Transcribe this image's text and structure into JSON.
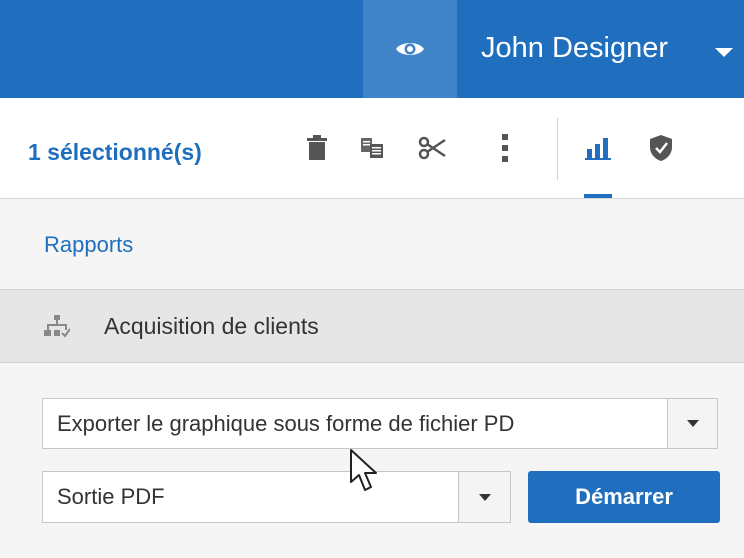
{
  "header": {
    "user_name": "John Designer",
    "icons": {
      "view": "eye-icon",
      "user_menu": "chevron-down-icon"
    }
  },
  "toolbar": {
    "selection_label": "1 sélectionné(s)",
    "icons": [
      "trash-icon",
      "copy-icon",
      "scissors-icon",
      "more-vertical-icon",
      "bar-chart-icon",
      "shield-icon"
    ],
    "active_tab": "bar-chart-icon"
  },
  "breadcrumb": {
    "label": "Rapports"
  },
  "section": {
    "title": "Acquisition de clients",
    "icon": "hierarchy-icon"
  },
  "export_select": {
    "value": "Exporter le graphique sous forme de fichier PD"
  },
  "output_select": {
    "value": "Sortie PDF"
  },
  "start_button": {
    "label": "Démarrer"
  },
  "colors": {
    "header_blue": "#1f6fbe",
    "eye_box_blue": "#3f84c9",
    "link_blue": "#1f6fbe",
    "section_gray": "#e6e6e6"
  }
}
